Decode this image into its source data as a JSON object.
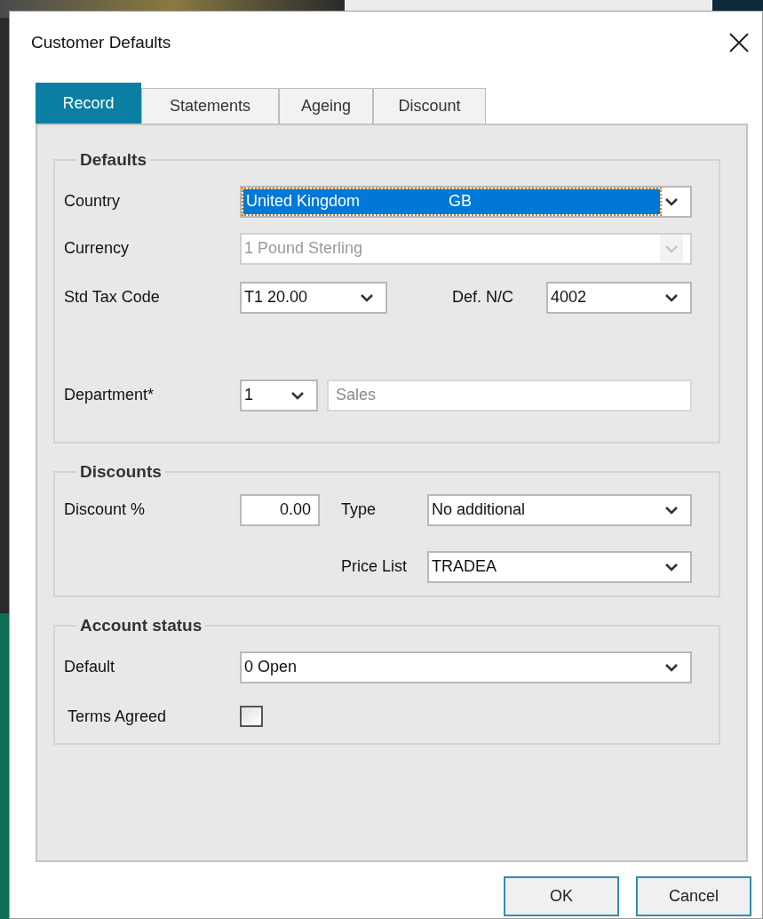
{
  "window": {
    "title": "Customer Defaults"
  },
  "tabs": [
    {
      "label": "Record",
      "selected": true
    },
    {
      "label": "Statements",
      "selected": false
    },
    {
      "label": "Ageing",
      "selected": false
    },
    {
      "label": "Discount",
      "selected": false
    }
  ],
  "defaults": {
    "legend": "Defaults",
    "country": {
      "label": "Country",
      "value": "United Kingdom",
      "code": "GB",
      "highlighted": true,
      "disabled": false
    },
    "currency": {
      "label": "Currency",
      "value": "1  Pound Sterling",
      "disabled": true
    },
    "tax_code": {
      "label": "Std Tax Code",
      "value": "T1  20.00",
      "disabled": false
    },
    "nominal_code": {
      "label": "Def. N/C",
      "value": "4002",
      "disabled": false
    },
    "department": {
      "label": "Department*",
      "value": "1",
      "disabled": false,
      "name": "Sales"
    }
  },
  "discounts": {
    "legend": "Discounts",
    "discount_percent": {
      "label": "Discount %",
      "value": "0.00"
    },
    "type": {
      "label": "Type",
      "value": "No additional",
      "disabled": false
    },
    "price_list": {
      "label": "Price List",
      "value": "TRADEA",
      "disabled": false
    }
  },
  "account_status": {
    "legend": "Account status",
    "default": {
      "label": "Default",
      "value": "0 Open",
      "disabled": false
    },
    "terms_agreed": {
      "label": "Terms Agreed",
      "checked": false
    }
  },
  "buttons": [
    "OK",
    "Cancel"
  ]
}
